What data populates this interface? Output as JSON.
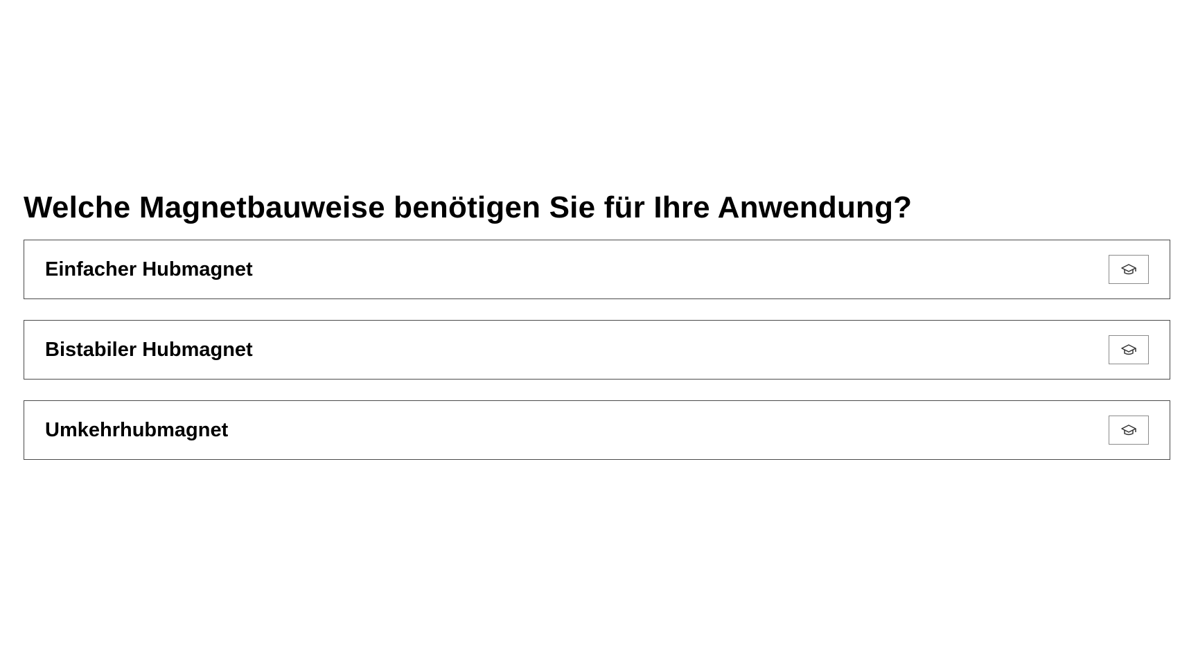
{
  "question": {
    "title": "Welche Magnetbauweise benötigen Sie für Ihre Anwendung?"
  },
  "options": [
    {
      "label": "Einfacher Hubmagnet",
      "icon": "graduation-cap-icon"
    },
    {
      "label": "Bistabiler Hubmagnet",
      "icon": "graduation-cap-icon"
    },
    {
      "label": "Umkehrhubmagnet",
      "icon": "graduation-cap-icon"
    }
  ]
}
